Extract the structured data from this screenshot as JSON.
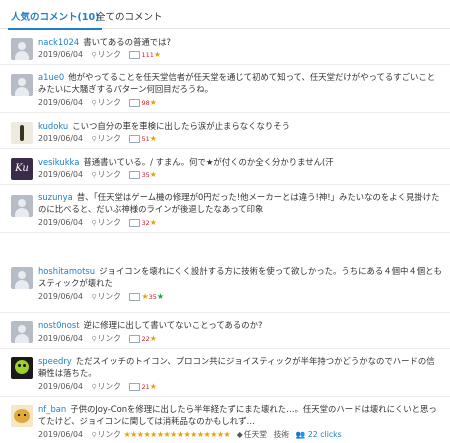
{
  "tabs": {
    "popular": "人気のコメント(10)",
    "all": "全てのコメント"
  },
  "common": {
    "date": "2019/06/04",
    "link": "リンク"
  },
  "comments": [
    {
      "user": "nack1024",
      "text": "書いてあるの普通では?",
      "n": "111",
      "stars": "★"
    },
    {
      "user": "a1ue0",
      "text": "他がやってることを任天堂信者が任天堂を通じて初めて知って、任天堂だけがやってるすごいことみたいに大騒ぎするパターン何回目だろうね。",
      "n": "98",
      "stars": "★"
    },
    {
      "user": "kudoku",
      "text": "こいつ自分の車を車検に出したら涙が止まらなくなりそう",
      "n": "51",
      "stars": "★"
    },
    {
      "user": "vesikukka",
      "text": "普通書いている。/ すまん。何で★が付くのか全く分かりません(汗",
      "n": "35",
      "stars": "★"
    },
    {
      "user": "suzunya",
      "text": "昔、「任天堂はゲーム機の修理が0円だった!他メーカーとは違う!神!」みたいなのをよく見掛けたのに比べると、だいぶ神様のラインが後退したなあって印象",
      "n": "32",
      "stars": "★"
    },
    {
      "user": "hoshitamotsu",
      "text": "ジョイコンを壊れにくく設計する方に技術を使って欲しかった。うちにある４個中４個ともスティックが壊れた",
      "n": "35",
      "stars": "★",
      "green": "★"
    },
    {
      "user": "nost0nost",
      "text": "逆に修理に出して書いてないことってあるのか?",
      "n": "22",
      "stars": "★"
    },
    {
      "user": "speedry",
      "text": "ただスイッチのトイコン、プロコン共にジョイスティックが半年持つかどうかなのでハードの信頼性は落ちた。",
      "n": "21",
      "stars": "★"
    },
    {
      "user": "nf_ban",
      "text": "子供のJoy-Conを修理に出したら半年経たずにまた壊れた…。任天堂のハードは壊れにくいと思ってたけど、ジョイコンに関しては消耗品なのかもしれず…",
      "stars_long": "★★★★★★★★★★★★★★★★",
      "tag": "任天堂",
      "tag2": "技術",
      "clicks": "22 clicks"
    }
  ]
}
